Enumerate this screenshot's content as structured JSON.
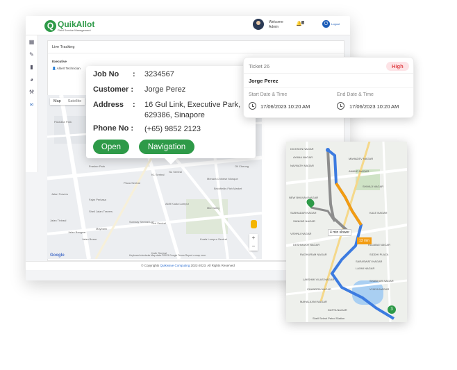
{
  "app": {
    "logo_letter": "Q",
    "logo_name": "QuikAllot",
    "logo_tagline": "Field Service Management",
    "welcome_line1": "Welcome",
    "welcome_line2": "Admin",
    "notification_count": "1",
    "logout_label": "Logout",
    "sidebar_icons": [
      "dashboard-icon",
      "pencil-icon",
      "briefcase-icon",
      "chart-pie-icon",
      "wrench-icon",
      "binoculars-icon"
    ],
    "page_title": "Live Tracking",
    "executive_label": "Executive",
    "executive_name": "Albert Technician",
    "footer_prefix": "© Copyrights",
    "footer_brand": "Quikwave Computing",
    "footer_suffix": "2022-2023. All Rights Reserved",
    "accent_color": "#2e9a48"
  },
  "map": {
    "tab_map": "Map",
    "tab_satellite": "Satellite",
    "zoom_in": "+",
    "zoom_out": "−",
    "google_logo": "Google",
    "attribution": "Keyboard shortcuts  Map data ©2023 Google  Terms  Report a map error",
    "labels": [
      "Jalan Tiviraal",
      "Jalan Besar",
      "Frasher Park",
      "Paradise Park",
      "Fajar Perkasa",
      "Plaza Sentral",
      "KL Sentral",
      "Jalan Travers",
      "Jalan Bangsar",
      "Maybank",
      "Sunway Sentral Lof",
      "Aloft Kuala Lumpur",
      "Nu Sentral",
      "Mid Valley",
      "Seri Sentral",
      "Menara Chinese Mosque",
      "Brickfields Fish Market",
      "Oil Cheong",
      "Restoran Rajakumar",
      "Kuala Lumpur Sentral",
      "Shell Jalan Travers",
      "Kafe Sentral"
    ]
  },
  "popup": {
    "job_no_label": "Job No",
    "job_no_value": "3234567",
    "customer_label": "Customer :",
    "customer_value": "Jorge Perez",
    "address_label": "Address",
    "address_line1": "16 Gul Link, Executive Park,",
    "address_line2": "629386, Sinapore",
    "phone_label": "Phone No :",
    "phone_value": "(+65) 9852 2123",
    "colon": ":",
    "open_button": "Open",
    "navigation_button": "Navigation"
  },
  "ticket": {
    "number": "Ticket 26",
    "priority": "High",
    "customer": "Jorge Perez",
    "start_label": "Start Date & Time",
    "start_value": "17/06/2023 10:20 AM",
    "end_label": "End Date & Time",
    "end_value": "17/06/2023 10:20 AM",
    "priority_color": "#e0474c"
  },
  "nav_map": {
    "eta_alt": "4 min slower",
    "eta_main": "13 min",
    "destination_number": "3",
    "destination_label": "Shell Select Petrol Station",
    "labels": [
      "DICKSON NAGAR",
      "AYANA NAGAR",
      "MAHADEV NAGAR",
      "NAVNATH NAGAR",
      "ANAND NAGAR",
      "SHIVAJI NAGAR",
      "NEW BHUVAN NAGAR",
      "SUBHADAR NAGAR",
      "KALE NAGAR",
      "SANKAR NAGAR",
      "RAJABAI NAGAR",
      "SIDDHI PLAZA",
      "VISHNU NAGAR",
      "DESHMUKH NAGAR",
      "SARASWATI NAGAR",
      "LAXMI NAGAR",
      "SHANKAR NAGAR",
      "RAGHURAM NAGAR",
      "LAKSHMI VILAS NAGAR",
      "CHANDRA NAGAR",
      "MAHALAXMI NAGAR",
      "VIJAYA NAGAR",
      "DATTA NAGAR"
    ]
  }
}
